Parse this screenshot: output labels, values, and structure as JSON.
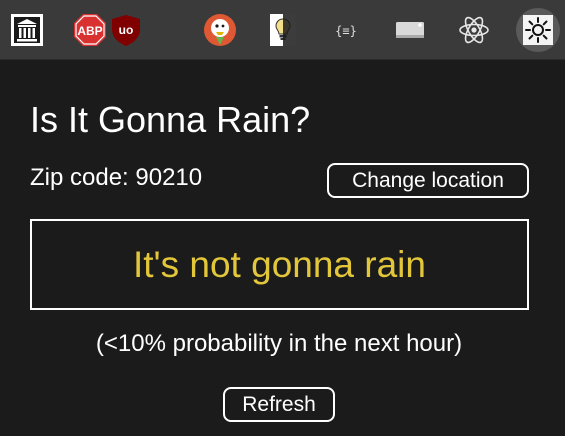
{
  "toolbar": {
    "extensions": [
      {
        "name": "library-columns-icon"
      },
      {
        "name": "adblock-plus-icon",
        "text": "ABP"
      },
      {
        "name": "ublock-origin-icon",
        "text": "uo"
      },
      {
        "name": "duckduckgo-icon"
      },
      {
        "name": "lightbulb-icon"
      },
      {
        "name": "json-formatter-icon",
        "text": "{≡}"
      },
      {
        "name": "screen-icon"
      },
      {
        "name": "react-devtools-icon"
      },
      {
        "name": "sun-icon",
        "active": true
      }
    ]
  },
  "popup": {
    "title": "Is It Gonna Rain?",
    "zip_label": "Zip code: 90210",
    "change_location_label": "Change location",
    "result": "It's not gonna rain",
    "probability": "(<10% probability in the next hour)",
    "refresh_label": "Refresh"
  },
  "colors": {
    "background": "#1b1b1b",
    "toolbar": "#3a3a3a",
    "result_text": "#e3c73a",
    "text": "#ffffff"
  }
}
